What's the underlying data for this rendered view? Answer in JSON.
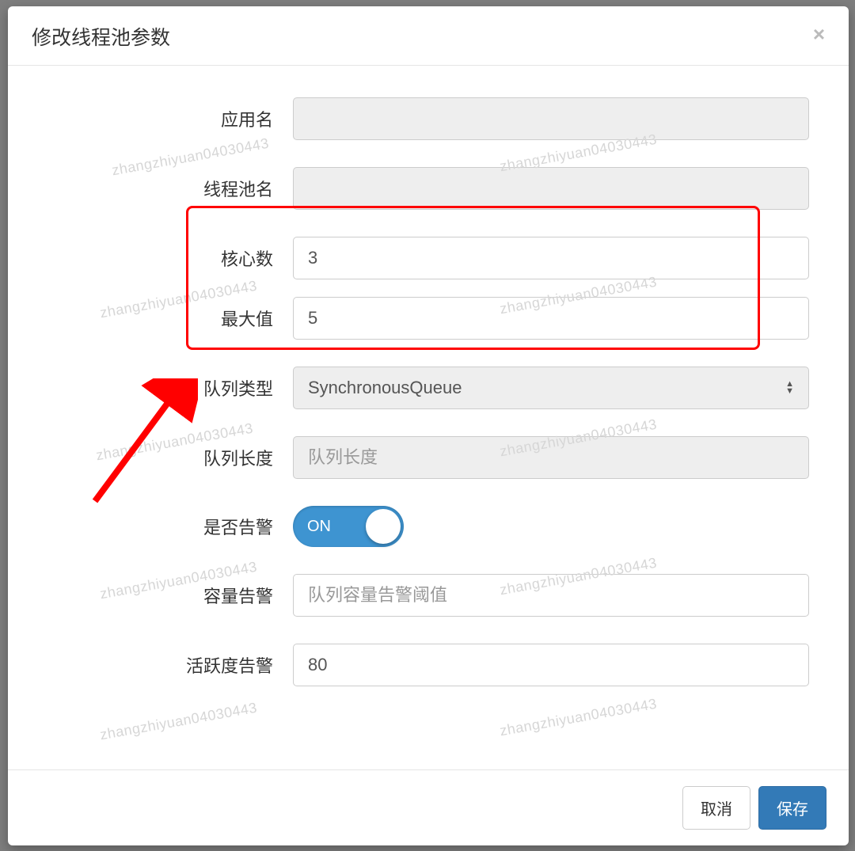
{
  "modal": {
    "title": "修改线程池参数"
  },
  "watermark": "zhangzhiyuan04030443",
  "watermark_partial": "zhangzhiyuan04030443",
  "form": {
    "app_name": {
      "label": "应用名",
      "value": ""
    },
    "pool_name": {
      "label": "线程池名",
      "value": ""
    },
    "core_count": {
      "label": "核心数",
      "value": "3"
    },
    "max_value": {
      "label": "最大值",
      "value": "5"
    },
    "queue_type": {
      "label": "队列类型",
      "value": "SynchronousQueue"
    },
    "queue_length": {
      "label": "队列长度",
      "placeholder": "队列长度",
      "value": ""
    },
    "alert_enabled": {
      "label": "是否告警",
      "state": "ON"
    },
    "capacity_alert": {
      "label": "容量告警",
      "placeholder": "队列容量告警阈值",
      "value": ""
    },
    "activity_alert": {
      "label": "活跃度告警",
      "value": "80"
    }
  },
  "footer": {
    "cancel": "取消",
    "save": "保存"
  }
}
